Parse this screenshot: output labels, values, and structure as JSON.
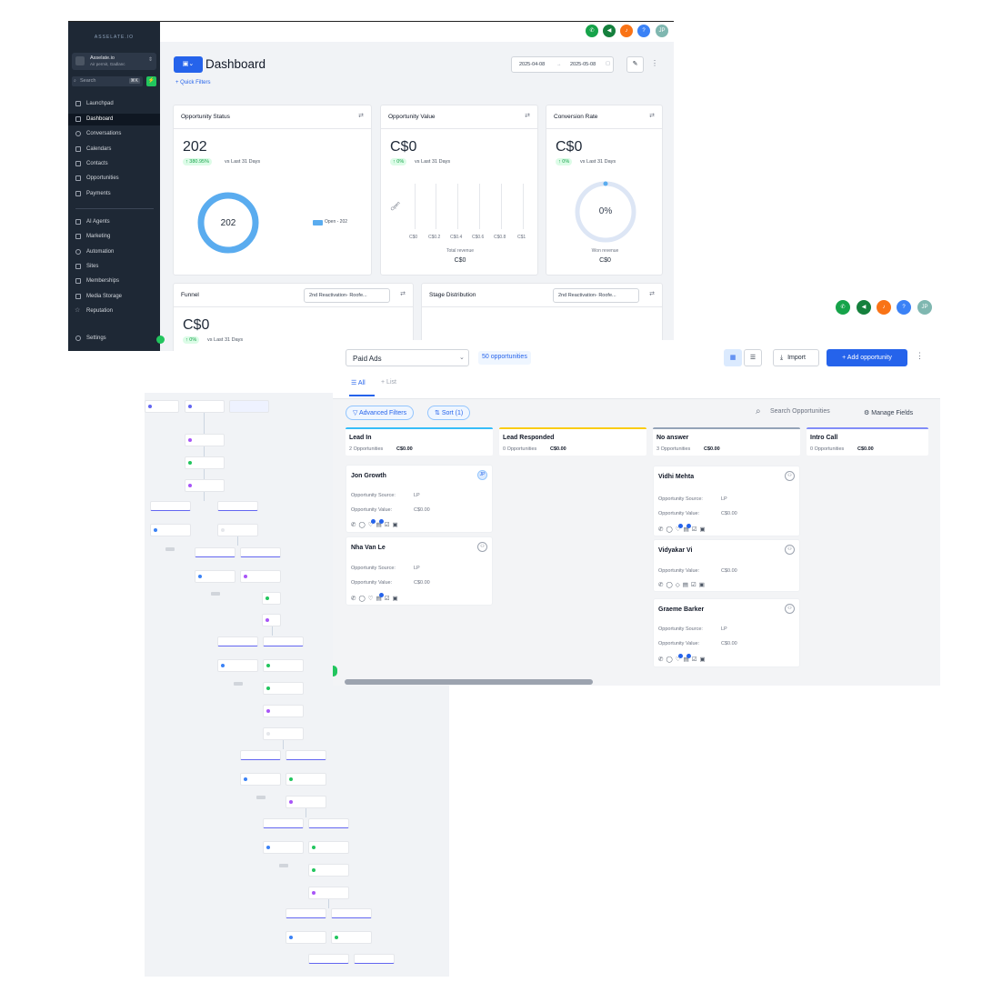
{
  "dashboard": {
    "brand": "ASSELATE.IO",
    "account": {
      "name": "Asselate.io",
      "subtitle": "Air permit, Gadlanc"
    },
    "search": {
      "placeholder": "Search",
      "shortcut": "⌘K"
    },
    "nav": [
      {
        "label": "Launchpad",
        "icon": "rocket-icon"
      },
      {
        "label": "Dashboard",
        "icon": "grid-icon",
        "active": true
      },
      {
        "label": "Conversations",
        "icon": "chat-icon"
      },
      {
        "label": "Calendars",
        "icon": "calendar-icon"
      },
      {
        "label": "Contacts",
        "icon": "contacts-icon"
      },
      {
        "label": "Opportunities",
        "icon": "opportunities-icon"
      },
      {
        "label": "Payments",
        "icon": "payments-icon"
      }
    ],
    "nav2": [
      {
        "label": "AI Agents",
        "icon": "ai-icon"
      },
      {
        "label": "Marketing",
        "icon": "send-icon"
      },
      {
        "label": "Automation",
        "icon": "automation-icon"
      },
      {
        "label": "Sites",
        "icon": "sites-icon"
      },
      {
        "label": "Memberships",
        "icon": "memberships-icon"
      },
      {
        "label": "Media Storage",
        "icon": "media-icon"
      },
      {
        "label": "Reputation",
        "icon": "star-icon"
      }
    ],
    "settings": "Settings",
    "title": "Dashboard",
    "quick_filters": "+ Quick Filters",
    "date_from": "2025-04-08",
    "date_to": "2025-05-08",
    "user_initials": "JP",
    "cards": {
      "status": {
        "title": "Opportunity Status",
        "value": "202",
        "change": "↑ 380.95%",
        "vs": "vs Last 31 Days",
        "donut": "202",
        "legend": "Open - 202"
      },
      "value": {
        "title": "Opportunity Value",
        "value": "C$0",
        "change": "↑ 0%",
        "vs": "vs Last 31 Days",
        "ticks": [
          "C$0",
          "C$0.2",
          "C$0.4",
          "C$0.6",
          "C$0.8",
          "C$1"
        ],
        "ylabel": "Open",
        "xlabel": "Total revenue",
        "total": "C$0"
      },
      "conversion": {
        "title": "Conversion Rate",
        "value": "C$0",
        "change": "↑ 0%",
        "vs": "vs Last 31 Days",
        "gauge": "0%",
        "label": "Won revenue",
        "total": "C$0"
      },
      "funnel": {
        "title": "Funnel",
        "select": "2nd Reactivation- Roofe...",
        "value": "C$0",
        "change": "↑ 0%",
        "vs": "vs Last 31 Days"
      },
      "stage": {
        "title": "Stage Distribution",
        "select": "2nd Reactivation- Roofe..."
      }
    }
  },
  "opportunities": {
    "user_initials": "JP",
    "pipeline": "Paid Ads",
    "count": "50 opportunities",
    "import": "Import",
    "add": "+ Add opportunity",
    "tabs": {
      "all": "All",
      "list": "List"
    },
    "advanced_filters": "Advanced Filters",
    "sort": "Sort (1)",
    "search_placeholder": "Search Opportunities",
    "manage_fields": "Manage Fields",
    "field_source": "Opportunity Source:",
    "field_value": "Opportunity Value:",
    "columns": [
      {
        "name": "Lead In",
        "count": "2 Opportunities",
        "value": "C$0.00",
        "color": "#38bdf8"
      },
      {
        "name": "Lead Responded",
        "count": "0 Opportunities",
        "value": "C$0.00",
        "color": "#facc15"
      },
      {
        "name": "No answer",
        "count": "3 Opportunities",
        "value": "C$0.00",
        "color": "#94a3b8"
      },
      {
        "name": "Intro Call",
        "count": "0 Opportunities",
        "value": "C$0.00",
        "color": "#818cf8"
      }
    ],
    "cards": [
      {
        "name": "Jon Growth",
        "avatar": "JP",
        "source": "LP",
        "value": "C$0.00"
      },
      {
        "name": "Nha Van Le",
        "source": "LP",
        "value": "C$0.00"
      },
      {
        "name": "Vidhi Mehta",
        "source": "LP",
        "value": "C$0.00"
      },
      {
        "name": "Vidyakar Vi",
        "value": "C$0.00"
      },
      {
        "name": "Graeme Barker",
        "source": "LP",
        "value": "C$0.00"
      }
    ]
  },
  "colors": {
    "primary": "#2563eb",
    "green": "#22c55e",
    "sidebar": "#1e2835"
  }
}
